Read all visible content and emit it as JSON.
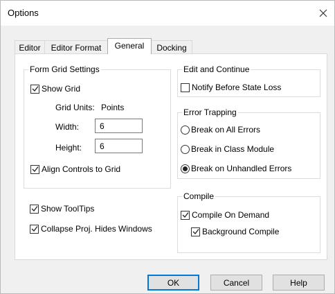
{
  "window": {
    "title": "Options",
    "close_glyph": "✕"
  },
  "tabs": [
    {
      "label": "Editor",
      "active": false
    },
    {
      "label": "Editor Format",
      "active": false
    },
    {
      "label": "General",
      "active": true
    },
    {
      "label": "Docking",
      "active": false
    }
  ],
  "form_grid": {
    "legend": "Form Grid Settings",
    "show_grid": {
      "label": "Show Grid",
      "checked": true
    },
    "units_label": "Grid Units:",
    "units_value": "Points",
    "width_label": "Width:",
    "width_value": "6",
    "height_label": "Height:",
    "height_value": "6",
    "align": {
      "label": "Align Controls to Grid",
      "checked": true
    }
  },
  "misc": {
    "show_tooltips": {
      "label": "Show ToolTips",
      "checked": true
    },
    "collapse_proj": {
      "label": "Collapse Proj. Hides Windows",
      "checked": true
    }
  },
  "edit_continue": {
    "legend": "Edit and Continue",
    "notify": {
      "label": "Notify Before State Loss",
      "checked": false
    }
  },
  "error_trapping": {
    "legend": "Error Trapping",
    "options": [
      {
        "label": "Break on All Errors",
        "selected": false
      },
      {
        "label": "Break in Class Module",
        "selected": false
      },
      {
        "label": "Break on Unhandled Errors",
        "selected": true
      }
    ]
  },
  "compile": {
    "legend": "Compile",
    "on_demand": {
      "label": "Compile On Demand",
      "checked": true
    },
    "background": {
      "label": "Background Compile",
      "checked": true
    }
  },
  "buttons": {
    "ok": "OK",
    "cancel": "Cancel",
    "help": "Help"
  },
  "colors": {
    "accent": "#0078d7",
    "panel_background": "#ffffff",
    "dialog_background": "#f0f0f0"
  },
  "icons": {
    "close": "close-icon",
    "check": "checkmark-icon",
    "radio_selected": "radio-dot-icon"
  }
}
